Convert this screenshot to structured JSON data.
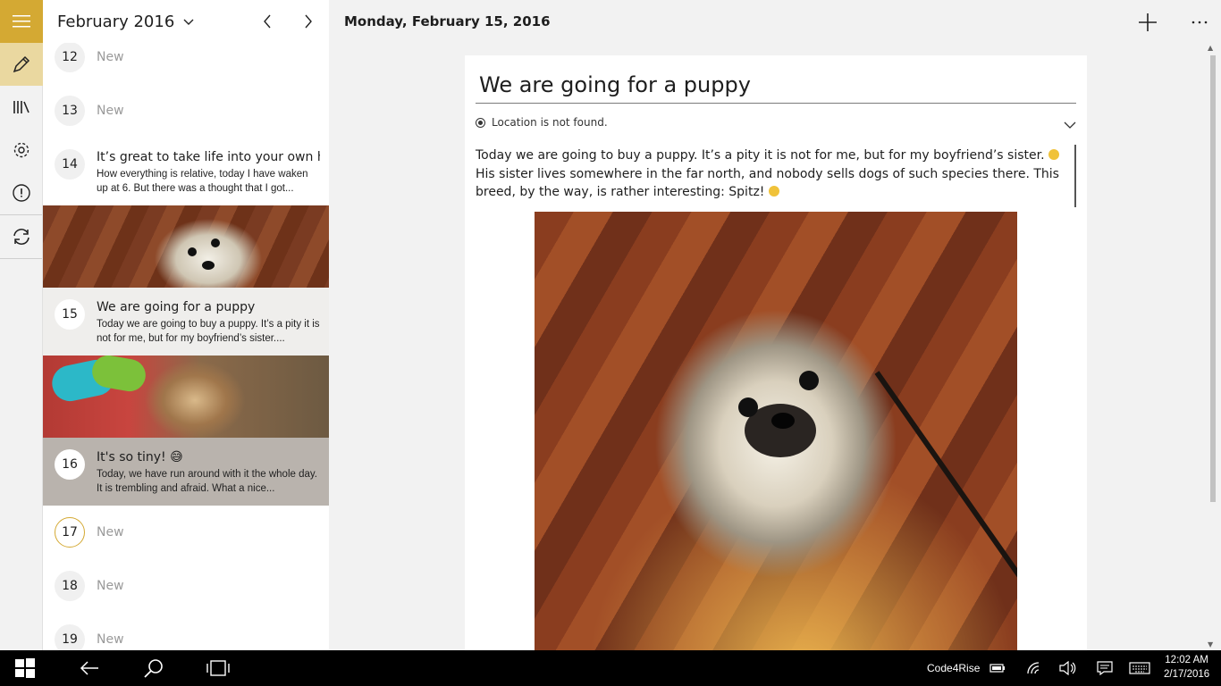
{
  "list": {
    "month_label": "February 2016",
    "days": [
      {
        "num": "12",
        "label": "New"
      },
      {
        "num": "13",
        "label": "New"
      },
      {
        "num": "14",
        "title": "It’s great to take life into your own ha",
        "preview": "How everything is relative, today I have waken up at 6. But there was a thought that I got..."
      },
      {
        "num": "15",
        "title": "We are going for a puppy",
        "preview": "Today we are going to buy a puppy. It’s a pity it is not for me, but for my boyfriend’s sister...."
      },
      {
        "num": "16",
        "title": "It's so tiny! 😅",
        "preview": "Today, we have run around with it the whole day. It is trembling and afraid. What a nice..."
      },
      {
        "num": "17",
        "label": "New"
      },
      {
        "num": "18",
        "label": "New"
      },
      {
        "num": "19",
        "label": "New"
      }
    ]
  },
  "main": {
    "date_title": "Monday, February 15, 2016",
    "entry_title": "We are going for a puppy",
    "location": "Location is not found.",
    "body_p1": "Today we are going to buy a puppy. It’s a pity it is not for me, but for my boyfriend’s sister.",
    "body_p2": "His sister lives somewhere in the far north, and nobody sells dogs of such species there. This breed, by the way, is rather interesting: Spitz!"
  },
  "taskbar": {
    "tray_label": "Code4Rise",
    "time": "12:02 AM",
    "date": "2/17/2016"
  },
  "colors": {
    "accent": "#d4a933",
    "active_rail": "#ead8a0"
  }
}
